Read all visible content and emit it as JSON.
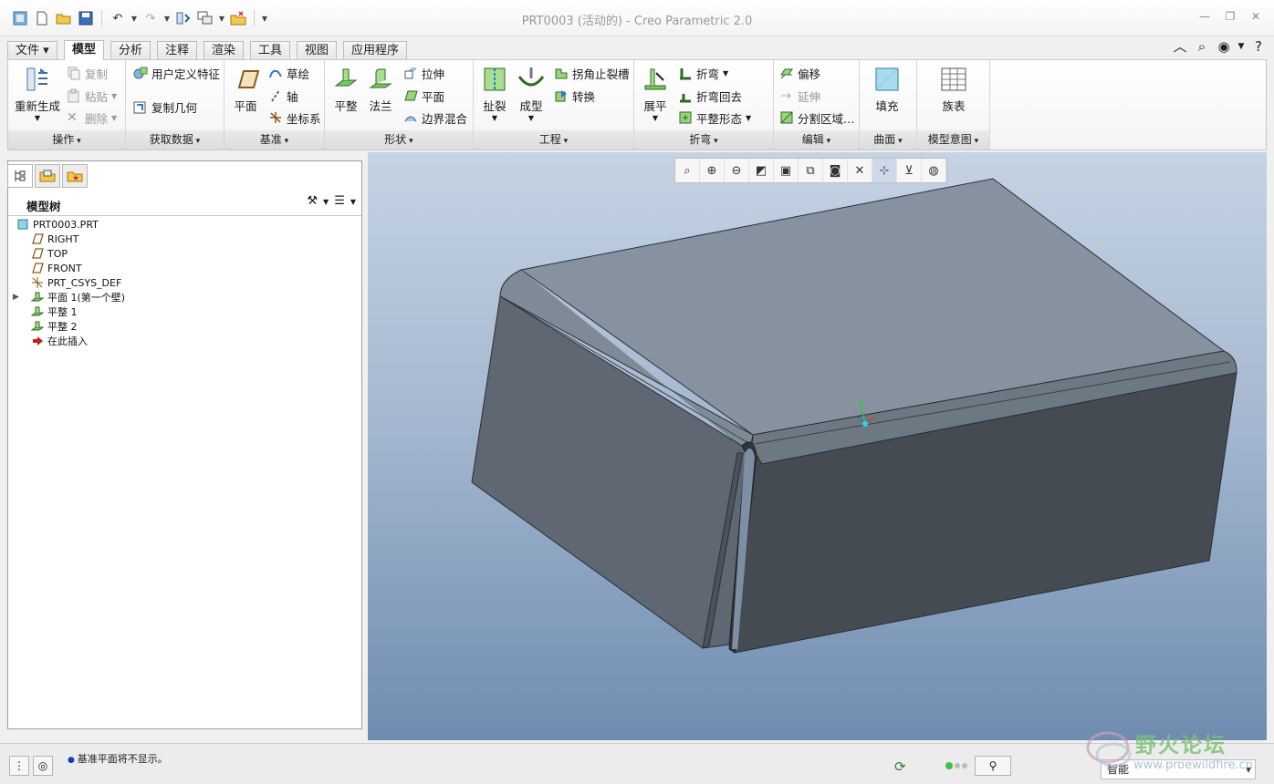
{
  "window": {
    "title": "PRT0003 (活动的) - Creo Parametric 2.0"
  },
  "quick_access": {
    "icons": [
      "app-icon",
      "new-icon",
      "open-icon",
      "save-icon",
      "undo-icon",
      "redo-icon",
      "regenerate-icon",
      "windows-icon",
      "close-window-icon",
      "customize-icon"
    ]
  },
  "tabs": [
    "文件",
    "模型",
    "分析",
    "注释",
    "渲染",
    "工具",
    "视图",
    "应用程序"
  ],
  "ribbon": {
    "operations": {
      "label": "操作",
      "regenerate": "重新生成",
      "copy": "复制",
      "paste": "粘贴",
      "delete": "删除"
    },
    "get_data": {
      "label": "获取数据",
      "udf": "用户定义特征",
      "copy_geom": "复制几何"
    },
    "datum": {
      "label": "基准",
      "plane": "平面",
      "sketch": "草绘",
      "axis": "轴",
      "csys": "坐标系"
    },
    "shapes": {
      "label": "形状",
      "flat": "平整",
      "flange": "法兰",
      "extrude": "拉伸",
      "planar": "平面",
      "blend": "边界混合"
    },
    "engineering": {
      "label": "工程",
      "rip": "扯裂",
      "form": "成型",
      "corner_relief": "拐角止裂槽",
      "convert": "转换"
    },
    "bends": {
      "label": "折弯",
      "unbend": "展平",
      "bend": "折弯",
      "bend_back": "折弯回去",
      "flat_pattern": "平整形态"
    },
    "editing": {
      "label": "编辑",
      "offset": "偏移",
      "extend": "延伸",
      "split": "分割区域…"
    },
    "surfaces": {
      "label": "曲面",
      "fill": "填充"
    },
    "intent": {
      "label": "模型意图",
      "family_table": "族表"
    }
  },
  "model_tree": {
    "title": "模型树",
    "items": [
      {
        "label": "PRT0003.PRT",
        "icon": "part-icon",
        "indent": 0,
        "expander": ""
      },
      {
        "label": "RIGHT",
        "icon": "datum-plane-icon",
        "indent": 1,
        "expander": ""
      },
      {
        "label": "TOP",
        "icon": "datum-plane-icon",
        "indent": 1,
        "expander": ""
      },
      {
        "label": "FRONT",
        "icon": "datum-plane-icon",
        "indent": 1,
        "expander": ""
      },
      {
        "label": "PRT_CSYS_DEF",
        "icon": "csys-icon",
        "indent": 1,
        "expander": ""
      },
      {
        "label": "平面 1(第一个壁)",
        "icon": "flat-wall-icon",
        "indent": 1,
        "expander": "▶"
      },
      {
        "label": "平整 1",
        "icon": "flat-wall-icon",
        "indent": 1,
        "expander": ""
      },
      {
        "label": "平整 2",
        "icon": "flat-wall-icon",
        "indent": 1,
        "expander": ""
      },
      {
        "label": "在此插入",
        "icon": "insert-here-icon",
        "indent": 1,
        "expander": ""
      }
    ]
  },
  "status": {
    "message": "基准平面将不显示。",
    "filter": "智能"
  },
  "watermark": {
    "text_cn": "野火论坛",
    "url": "www.proewildfire.cn"
  }
}
